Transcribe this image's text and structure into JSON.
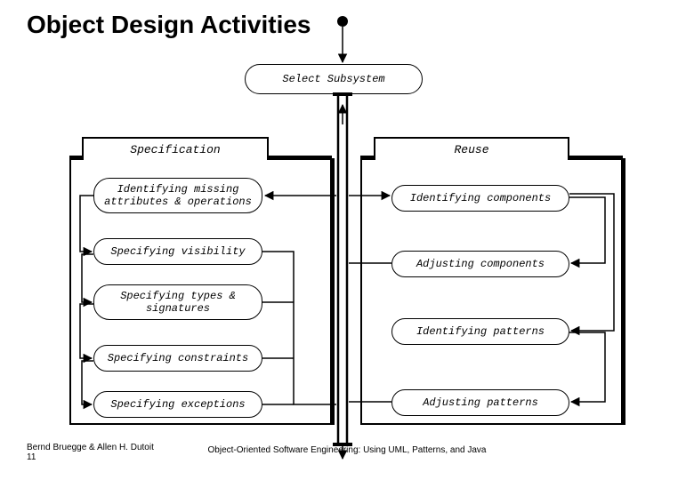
{
  "title": "Object Design Activities",
  "top_node": "Select Subsystem",
  "left_tab": "Specification",
  "right_tab": "Reuse",
  "left_nodes": [
    "Identifying missing attributes & operations",
    "Specifying visibility",
    "Specifying types & signatures",
    "Specifying constraints",
    "Specifying exceptions"
  ],
  "right_nodes": [
    "Identifying components",
    "Adjusting components",
    "Identifying patterns",
    "Adjusting patterns"
  ],
  "footer_author": "Bernd Bruegge & Allen H. Dutoit",
  "footer_page": "11",
  "footer_center": "Object-Oriented Software Engineering: Using UML, Patterns, and Java"
}
